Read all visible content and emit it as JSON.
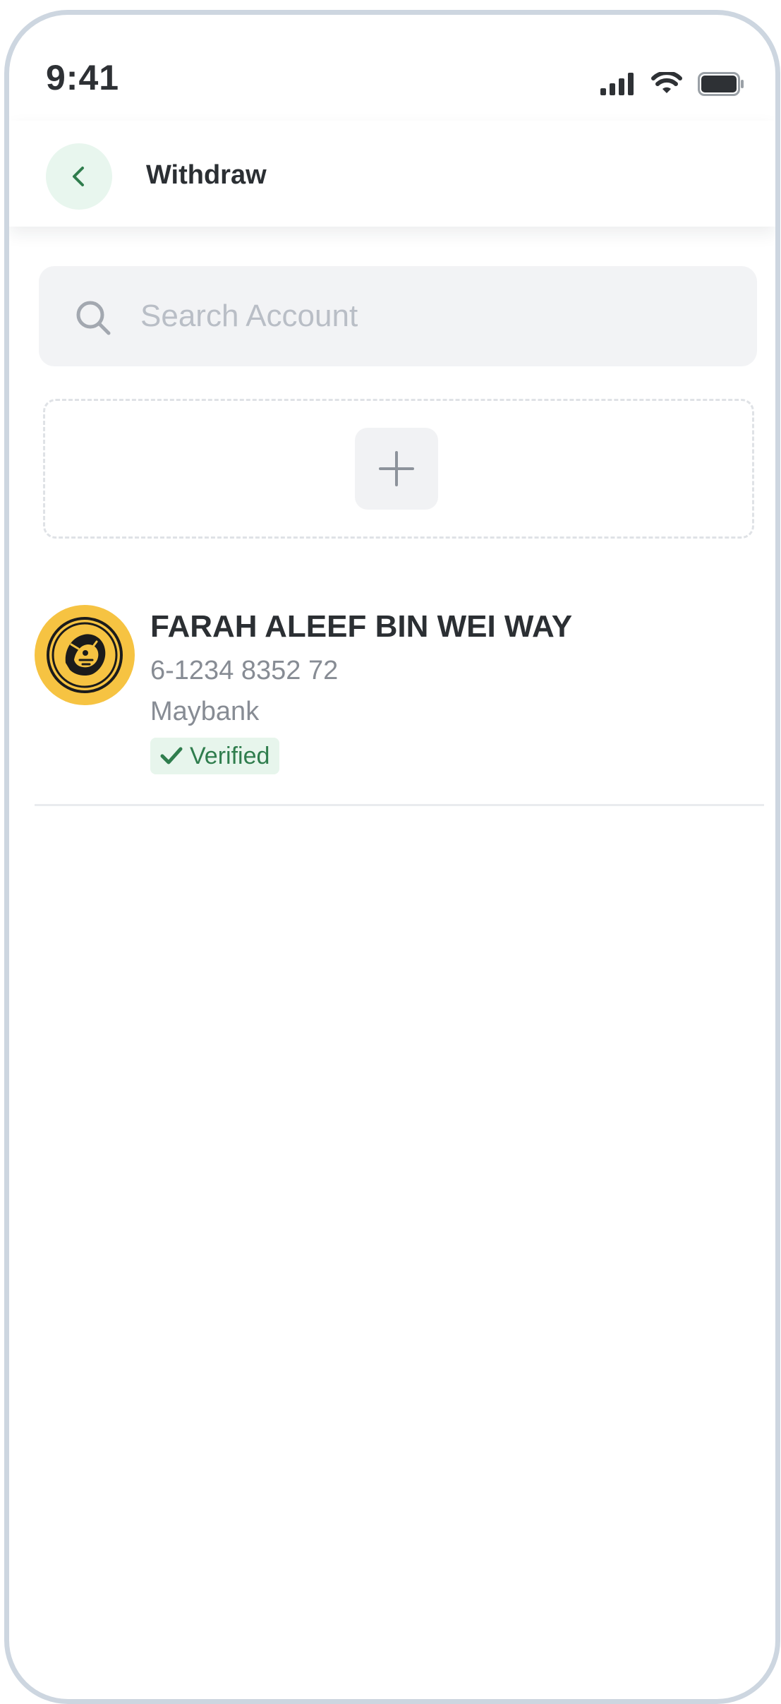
{
  "status_bar": {
    "time": "9:41"
  },
  "header": {
    "title": "Withdraw"
  },
  "search": {
    "placeholder": "Search Account",
    "value": ""
  },
  "account": {
    "name": "FARAH ALEEF BIN WEI WAY",
    "number": "6-1234 8352 72",
    "bank": "Maybank",
    "status": "Verified"
  },
  "colors": {
    "accent_green": "#2f7d4d",
    "back_button_bg": "#e8f6ee",
    "bank_logo_yellow": "#f6c342"
  },
  "icons": {
    "back": "chevron-left-icon",
    "search": "search-icon",
    "add": "plus-icon",
    "verified": "check-icon",
    "bank": "maybank-tiger-logo"
  }
}
